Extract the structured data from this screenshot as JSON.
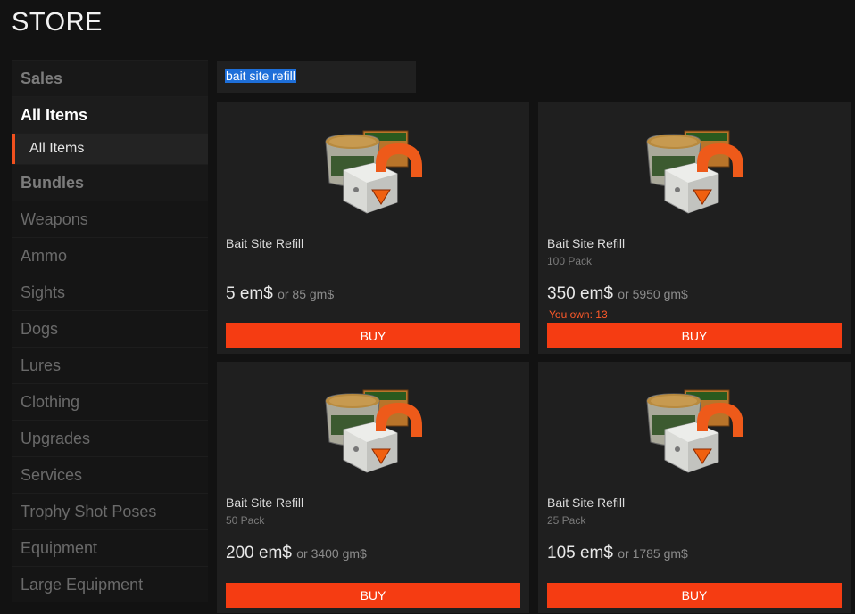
{
  "header": {
    "title": "STORE"
  },
  "search": {
    "value": "bait site refill"
  },
  "sidebar": {
    "sections": [
      {
        "label": "Sales"
      },
      {
        "label": "All Items"
      },
      {
        "label": "All Items"
      },
      {
        "label": "Bundles"
      }
    ],
    "items": [
      {
        "label": "Weapons"
      },
      {
        "label": "Ammo"
      },
      {
        "label": "Sights"
      },
      {
        "label": "Dogs"
      },
      {
        "label": "Lures"
      },
      {
        "label": "Clothing"
      },
      {
        "label": "Upgrades"
      },
      {
        "label": "Services"
      },
      {
        "label": "Trophy Shot Poses"
      },
      {
        "label": "Equipment"
      },
      {
        "label": "Large Equipment"
      }
    ]
  },
  "products": [
    {
      "name": "Bait Site Refill",
      "pack": "",
      "price_em": "5 em$",
      "price_gm": "or 85 gm$",
      "owned": "",
      "buy_label": "BUY",
      "icon": "bait-site-refill-icon"
    },
    {
      "name": "Bait Site Refill",
      "pack": "100 Pack",
      "price_em": "350 em$",
      "price_gm": "or 5950 gm$",
      "owned": "You own: 13",
      "buy_label": "BUY",
      "icon": "bait-site-refill-icon"
    },
    {
      "name": "Bait Site Refill",
      "pack": "50 Pack",
      "price_em": "200 em$",
      "price_gm": "or 3400 gm$",
      "owned": "",
      "buy_label": "BUY",
      "icon": "bait-site-refill-icon"
    },
    {
      "name": "Bait Site Refill",
      "pack": "25 Pack",
      "price_em": "105 em$",
      "price_gm": "or 1785 gm$",
      "owned": "",
      "buy_label": "BUY",
      "icon": "bait-site-refill-icon"
    }
  ],
  "colors": {
    "accent": "#f53c12",
    "background": "#121212",
    "card": "#1f1f1f",
    "owned_text": "#ff5a2a"
  }
}
